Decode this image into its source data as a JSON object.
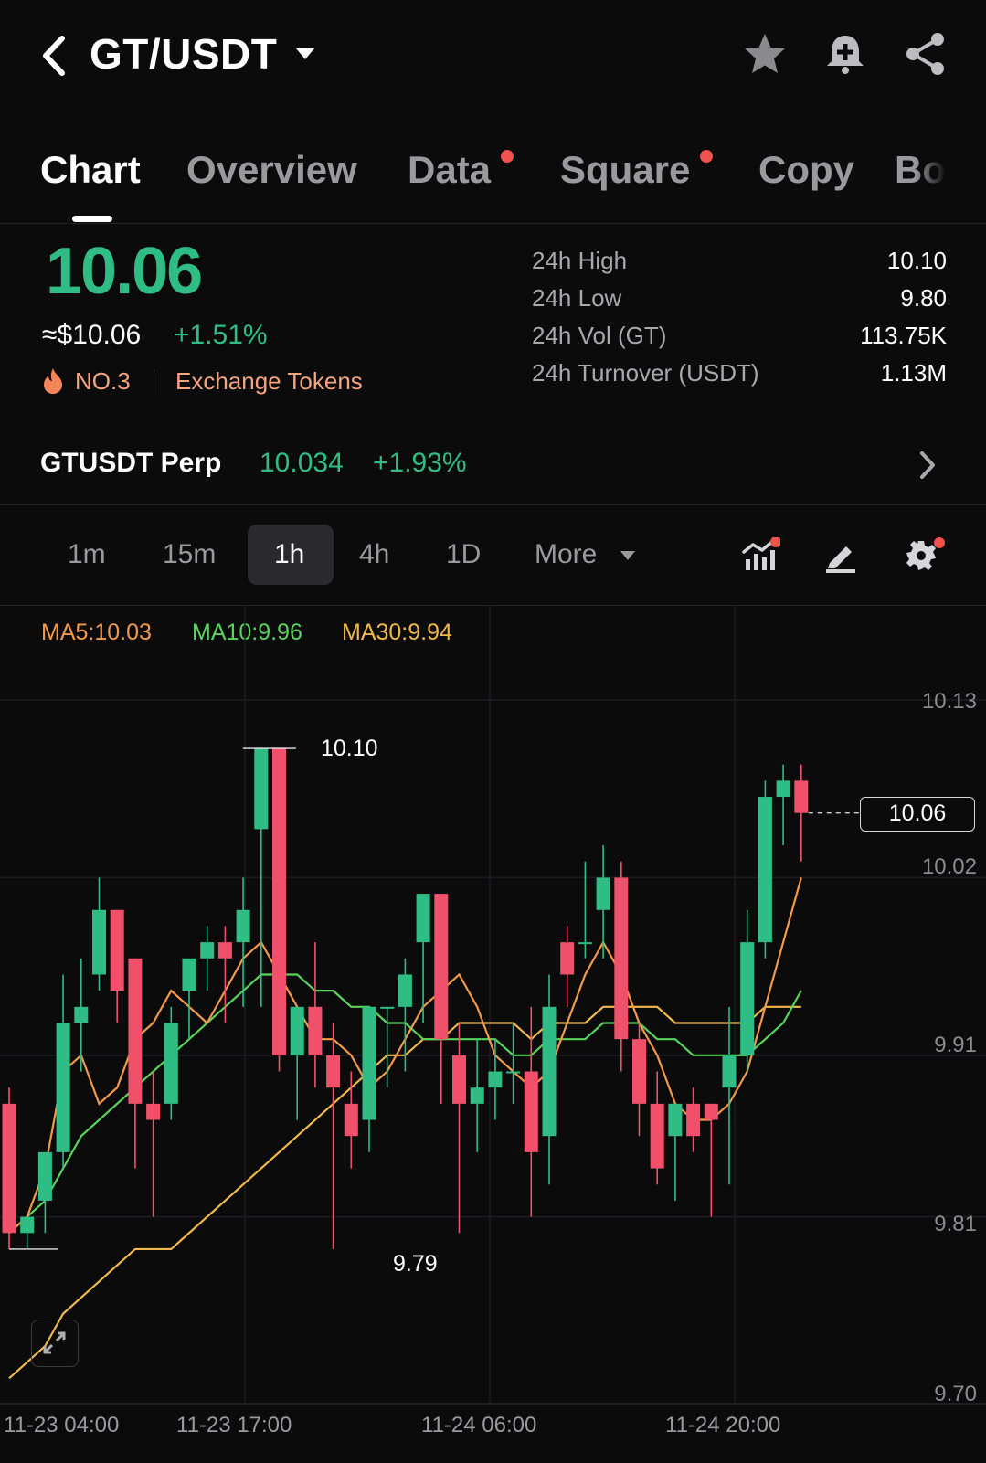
{
  "header": {
    "pair": "GT/USDT",
    "icons": [
      "back-chevron-icon",
      "dropdown-caret-icon",
      "star-icon",
      "bell-plus-icon",
      "share-icon"
    ]
  },
  "tabs": [
    {
      "label": "Chart",
      "active": true,
      "dot": false
    },
    {
      "label": "Overview",
      "active": false,
      "dot": false
    },
    {
      "label": "Data",
      "active": false,
      "dot": true
    },
    {
      "label": "Square",
      "active": false,
      "dot": true
    },
    {
      "label": "Copy",
      "active": false,
      "dot": false
    },
    {
      "label": "Bo",
      "active": false,
      "dot": false
    }
  ],
  "price": {
    "last": "10.06",
    "usd": "≈$10.06",
    "change": "+1.51%",
    "rank": "NO.3",
    "category": "Exchange Tokens"
  },
  "stats": [
    {
      "label": "24h High",
      "value": "10.10"
    },
    {
      "label": "24h Low",
      "value": "9.80"
    },
    {
      "label": "24h Vol (GT)",
      "value": "113.75K"
    },
    {
      "label": "24h Turnover (USDT)",
      "value": "1.13M"
    }
  ],
  "perp": {
    "name": "GTUSDT Perp",
    "price": "10.034",
    "change": "+1.93%"
  },
  "intervals": [
    "1m",
    "15m",
    "1h",
    "4h",
    "1D"
  ],
  "active_interval": "1h",
  "more_label": "More",
  "ma_legend": {
    "ma5": "MA5:10.03",
    "ma10": "MA10:9.96",
    "ma30": "MA30:9.94"
  },
  "colors": {
    "up": "#2fbd85",
    "down": "#f0506a",
    "ma5": "#f39a4a",
    "ma10": "#5ad35a",
    "ma30": "#f0b84a",
    "accent_dot": "#f0524d"
  },
  "chart_data": {
    "type": "candlestick",
    "y_ticks": [
      "10.13",
      "10.02",
      "9.91",
      "9.81",
      "9.70"
    ],
    "x_ticks": [
      "11-23 04:00",
      "11-23 17:00",
      "11-24 06:00",
      "11-24 20:00"
    ],
    "ylim": [
      9.7,
      10.13
    ],
    "current_price_label": "10.06",
    "high_marker": "10.10",
    "low_marker": "9.79",
    "candles": [
      {
        "o": 9.88,
        "h": 9.89,
        "l": 9.79,
        "c": 9.8
      },
      {
        "o": 9.8,
        "h": 9.81,
        "l": 9.79,
        "c": 9.81
      },
      {
        "o": 9.82,
        "h": 9.85,
        "l": 9.8,
        "c": 9.85
      },
      {
        "o": 9.85,
        "h": 9.96,
        "l": 9.84,
        "c": 9.93
      },
      {
        "o": 9.93,
        "h": 9.97,
        "l": 9.9,
        "c": 9.94
      },
      {
        "o": 9.96,
        "h": 10.02,
        "l": 9.95,
        "c": 10.0
      },
      {
        "o": 10.0,
        "h": 10.0,
        "l": 9.93,
        "c": 9.95
      },
      {
        "o": 9.97,
        "h": 9.97,
        "l": 9.84,
        "c": 9.88
      },
      {
        "o": 9.88,
        "h": 9.9,
        "l": 9.81,
        "c": 9.87
      },
      {
        "o": 9.88,
        "h": 9.94,
        "l": 9.87,
        "c": 9.93
      },
      {
        "o": 9.95,
        "h": 9.96,
        "l": 9.92,
        "c": 9.97
      },
      {
        "o": 9.97,
        "h": 9.99,
        "l": 9.95,
        "c": 9.98
      },
      {
        "o": 9.98,
        "h": 9.99,
        "l": 9.93,
        "c": 9.97
      },
      {
        "o": 9.98,
        "h": 10.02,
        "l": 9.94,
        "c": 10.0
      },
      {
        "o": 10.05,
        "h": 10.1,
        "l": 9.94,
        "c": 10.1
      },
      {
        "o": 10.1,
        "h": 10.1,
        "l": 9.9,
        "c": 9.91
      },
      {
        "o": 9.91,
        "h": 9.94,
        "l": 9.87,
        "c": 9.94
      },
      {
        "o": 9.94,
        "h": 9.98,
        "l": 9.89,
        "c": 9.91
      },
      {
        "o": 9.91,
        "h": 9.93,
        "l": 9.79,
        "c": 9.89
      },
      {
        "o": 9.88,
        "h": 9.9,
        "l": 9.84,
        "c": 9.86
      },
      {
        "o": 9.87,
        "h": 9.94,
        "l": 9.85,
        "c": 9.94
      },
      {
        "o": 9.94,
        "h": 9.94,
        "l": 9.89,
        "c": 9.94
      },
      {
        "o": 9.94,
        "h": 9.97,
        "l": 9.9,
        "c": 9.96
      },
      {
        "o": 9.98,
        "h": 10.01,
        "l": 9.93,
        "c": 10.01
      },
      {
        "o": 10.01,
        "h": 10.01,
        "l": 9.88,
        "c": 9.92
      },
      {
        "o": 9.91,
        "h": 9.93,
        "l": 9.8,
        "c": 9.88
      },
      {
        "o": 9.88,
        "h": 9.92,
        "l": 9.85,
        "c": 9.89
      },
      {
        "o": 9.89,
        "h": 9.92,
        "l": 9.87,
        "c": 9.9
      },
      {
        "o": 9.9,
        "h": 9.93,
        "l": 9.88,
        "c": 9.9
      },
      {
        "o": 9.9,
        "h": 9.94,
        "l": 9.81,
        "c": 9.85
      },
      {
        "o": 9.86,
        "h": 9.96,
        "l": 9.83,
        "c": 9.94
      },
      {
        "o": 9.98,
        "h": 9.99,
        "l": 9.94,
        "c": 9.96
      },
      {
        "o": 9.98,
        "h": 10.03,
        "l": 9.97,
        "c": 9.98
      },
      {
        "o": 10.0,
        "h": 10.04,
        "l": 9.97,
        "c": 10.02
      },
      {
        "o": 10.02,
        "h": 10.03,
        "l": 9.9,
        "c": 9.92
      },
      {
        "o": 9.92,
        "h": 9.93,
        "l": 9.86,
        "c": 9.88
      },
      {
        "o": 9.88,
        "h": 9.9,
        "l": 9.83,
        "c": 9.84
      },
      {
        "o": 9.86,
        "h": 9.88,
        "l": 9.82,
        "c": 9.88
      },
      {
        "o": 9.88,
        "h": 9.89,
        "l": 9.85,
        "c": 9.86
      },
      {
        "o": 9.88,
        "h": 9.88,
        "l": 9.81,
        "c": 9.87
      },
      {
        "o": 9.89,
        "h": 9.94,
        "l": 9.83,
        "c": 9.91
      },
      {
        "o": 9.91,
        "h": 10.0,
        "l": 9.9,
        "c": 9.98
      },
      {
        "o": 9.98,
        "h": 10.08,
        "l": 9.97,
        "c": 10.07
      },
      {
        "o": 10.07,
        "h": 10.09,
        "l": 10.04,
        "c": 10.08
      },
      {
        "o": 10.08,
        "h": 10.09,
        "l": 10.03,
        "c": 10.06
      }
    ],
    "ma5": [
      9.8,
      9.81,
      9.84,
      9.9,
      9.91,
      9.88,
      9.89,
      9.92,
      9.93,
      9.95,
      9.94,
      9.93,
      9.95,
      9.97,
      9.98,
      9.96,
      9.94,
      9.92,
      9.92,
      9.91,
      9.89,
      9.9,
      9.92,
      9.94,
      9.95,
      9.96,
      9.94,
      9.91,
      9.9,
      9.89,
      9.9,
      9.93,
      9.96,
      9.98,
      9.96,
      9.93,
      9.91,
      9.88,
      9.87,
      9.87,
      9.88,
      9.9,
      9.94,
      9.98,
      10.02
    ],
    "ma10": [
      9.8,
      9.81,
      9.82,
      9.84,
      9.86,
      9.87,
      9.88,
      9.89,
      9.9,
      9.91,
      9.92,
      9.93,
      9.94,
      9.95,
      9.96,
      9.96,
      9.96,
      9.95,
      9.95,
      9.94,
      9.94,
      9.93,
      9.93,
      9.92,
      9.92,
      9.92,
      9.92,
      9.92,
      9.91,
      9.91,
      9.92,
      9.92,
      9.92,
      9.93,
      9.93,
      9.93,
      9.92,
      9.92,
      9.91,
      9.91,
      9.91,
      9.91,
      9.92,
      9.93,
      9.95
    ],
    "ma30": [
      9.71,
      9.72,
      9.73,
      9.75,
      9.76,
      9.77,
      9.78,
      9.79,
      9.79,
      9.79,
      9.8,
      9.81,
      9.82,
      9.83,
      9.84,
      9.85,
      9.86,
      9.87,
      9.88,
      9.89,
      9.9,
      9.91,
      9.91,
      9.92,
      9.92,
      9.93,
      9.93,
      9.93,
      9.93,
      9.92,
      9.93,
      9.93,
      9.93,
      9.94,
      9.94,
      9.94,
      9.94,
      9.93,
      9.93,
      9.93,
      9.93,
      9.93,
      9.94,
      9.94,
      9.94
    ]
  }
}
